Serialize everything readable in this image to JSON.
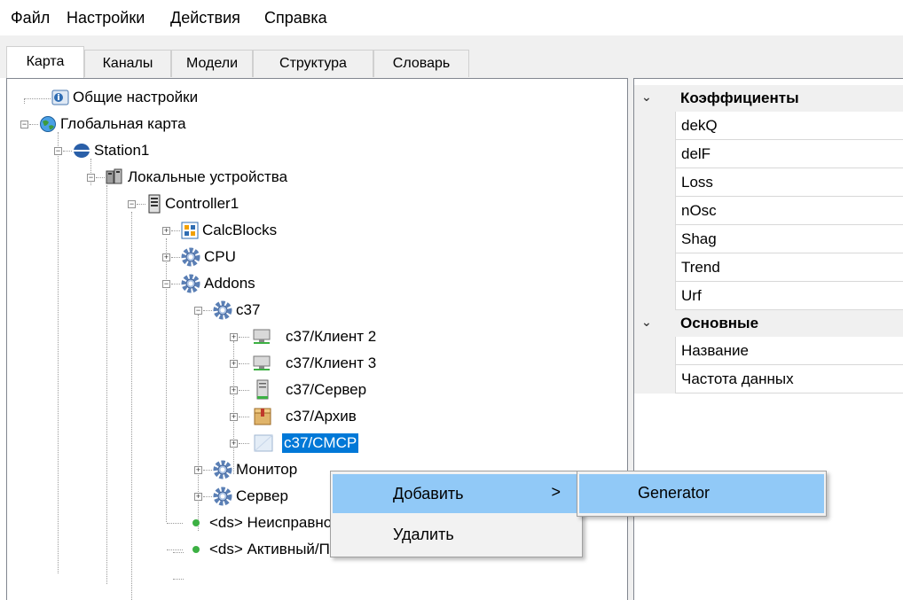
{
  "menubar": {
    "items": [
      "Файл",
      "Настройки",
      "Действия",
      "Справка"
    ]
  },
  "tabs": [
    {
      "label": "Карта",
      "active": true
    },
    {
      "label": "Каналы",
      "active": false
    },
    {
      "label": "Модели",
      "active": false
    },
    {
      "label": "Структура",
      "active": false
    },
    {
      "label": "Словарь",
      "active": false
    }
  ],
  "tree": {
    "items": [
      {
        "label": "Общие настройки",
        "icon": "settings-info-icon"
      },
      {
        "label": "Глобальная карта",
        "icon": "globe-icon",
        "expanded": true
      },
      {
        "label": "Station1",
        "icon": "station-icon",
        "expanded": true
      },
      {
        "label": "Локальные устройства",
        "icon": "devices-icon",
        "expanded": true
      },
      {
        "label": "Controller1",
        "icon": "controller-icon",
        "expanded": true
      },
      {
        "label": "CalcBlocks",
        "icon": "calcblocks-icon",
        "expanded": false
      },
      {
        "label": "CPU",
        "icon": "gear-icon",
        "expanded": false
      },
      {
        "label": "Addons",
        "icon": "gear-icon",
        "expanded": true
      },
      {
        "label": "c37",
        "icon": "gear-icon",
        "expanded": true
      },
      {
        "label": "c37/Клиент 2",
        "icon": "client-icon",
        "expanded": false
      },
      {
        "label": "c37/Клиент 3",
        "icon": "client-icon",
        "expanded": false
      },
      {
        "label": "c37/Сервер",
        "icon": "server-icon",
        "expanded": false
      },
      {
        "label": "c37/Архив",
        "icon": "archive-icon",
        "expanded": false
      },
      {
        "label": "c37/CMCP",
        "icon": "module-icon",
        "expanded": false,
        "selected": true
      },
      {
        "label": "Монитор",
        "icon": "gear-icon",
        "expanded": false
      },
      {
        "label": "Сервер",
        "icon": "gear-icon",
        "expanded": false
      },
      {
        "label": "<ds> Неисправность",
        "icon": "green-dot-icon"
      },
      {
        "label": "<ds> Активный/Пассивный <- Активный/Па",
        "icon": "green-dot-icon"
      }
    ]
  },
  "properties": {
    "categories": [
      {
        "name": "Коэффициенты",
        "rows": [
          "dekQ",
          "delF",
          "Loss",
          "nOsc",
          "Shag",
          "Trend",
          "Urf"
        ]
      },
      {
        "name": "Основные",
        "rows": [
          "Название",
          "Частота данных"
        ]
      }
    ]
  },
  "context_menu": {
    "items": [
      {
        "label": "Добавить",
        "has_submenu": true,
        "highlighted": true
      },
      {
        "label": "Удалить",
        "has_submenu": false,
        "highlighted": false
      }
    ],
    "submenu_arrow": ">",
    "submenu": {
      "items": [
        "Generator"
      ]
    }
  },
  "colors": {
    "selection": "#0078d7",
    "menu_highlight": "#91c9f7",
    "category_bg": "#f0f0f0",
    "status_green": "#3cb043"
  }
}
